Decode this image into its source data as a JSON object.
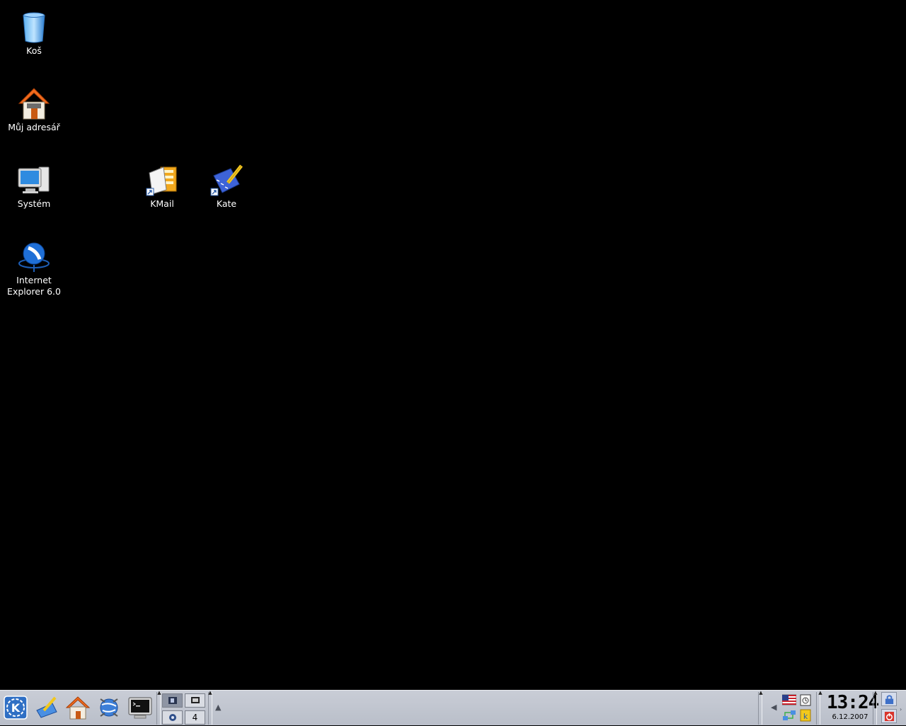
{
  "desktop": {
    "icons": [
      {
        "name": "trash-icon",
        "label": "Koš"
      },
      {
        "name": "home-folder-icon",
        "label": "Můj adresář"
      },
      {
        "name": "system-icon",
        "label": "Systém"
      },
      {
        "name": "internet-explorer-icon",
        "label": "Internet\nExplorer 6.0"
      },
      {
        "name": "kmail-icon",
        "label": "KMail"
      },
      {
        "name": "kate-icon",
        "label": "Kate"
      }
    ]
  },
  "taskbar": {
    "launchers": [
      "kde-menu-icon",
      "desktop-icon",
      "home-icon",
      "konqueror-icon",
      "terminal-icon"
    ],
    "pager": {
      "desktops": [
        "1",
        "2",
        "3",
        "4"
      ],
      "active_desktop": "1"
    },
    "clock": {
      "time": "13:24",
      "date": "6.12.2007"
    },
    "tray": [
      "us-flag-icon",
      "klipper-icon",
      "network-icon",
      "kde-update-icon"
    ],
    "session": [
      "lock-screen-icon",
      "logout-icon"
    ]
  },
  "colors": {
    "desktop_bg": "#000000",
    "taskbar_bg": "#c4c8d2",
    "icon_label": "#ffffff"
  }
}
